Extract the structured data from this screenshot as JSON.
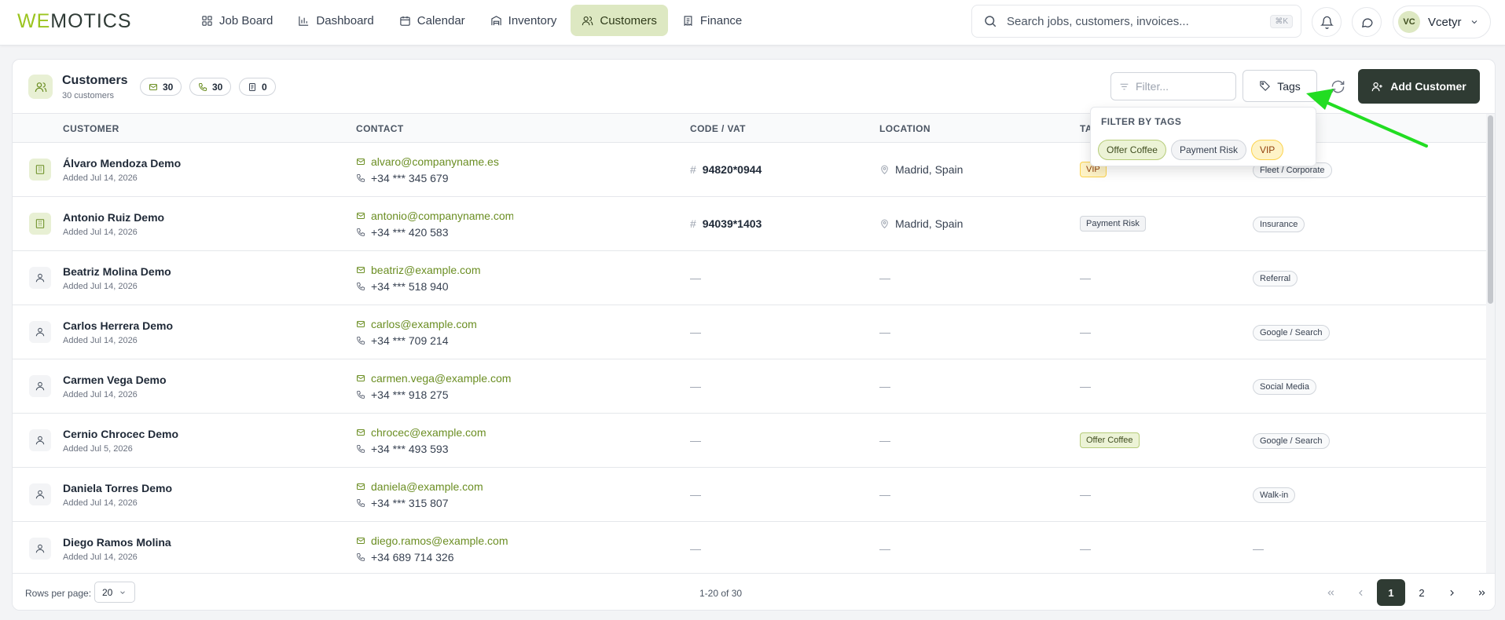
{
  "app": {
    "logo_part1": "WE",
    "logo_part2": "MOTICS"
  },
  "nav": [
    {
      "label": "Job Board",
      "icon": "grid-icon"
    },
    {
      "label": "Dashboard",
      "icon": "bar-chart-icon"
    },
    {
      "label": "Calendar",
      "icon": "calendar-icon"
    },
    {
      "label": "Inventory",
      "icon": "warehouse-icon"
    },
    {
      "label": "Customers",
      "icon": "users-icon",
      "active": true
    },
    {
      "label": "Finance",
      "icon": "receipt-icon"
    }
  ],
  "search": {
    "placeholder": "Search jobs, customers, invoices...",
    "shortcut": "⌘K"
  },
  "user": {
    "initials": "VC",
    "name": "Vcetyr"
  },
  "page": {
    "title": "Customers",
    "subtitle": "30 customers",
    "stats": [
      {
        "icon": "mail-icon",
        "value": "30"
      },
      {
        "icon": "phone-icon",
        "value": "30"
      },
      {
        "icon": "document-icon",
        "value": "0"
      }
    ],
    "filter_placeholder": "Filter...",
    "tags_label": "Tags",
    "add_label": "Add Customer"
  },
  "columns": [
    "CUSTOMER",
    "CONTACT",
    "CODE / VAT",
    "LOCATION",
    "TA"
  ],
  "dropdown": {
    "title": "FILTER BY TAGS",
    "tags": [
      "Offer Coffee",
      "Payment Risk",
      "VIP"
    ]
  },
  "rows": [
    {
      "type": "company",
      "name": "Álvaro Mendoza Demo",
      "added": "Added Jul 14, 2026",
      "email": "alvaro@companyname.es",
      "phone": "+34 *** 345 679",
      "code": "94820*0944",
      "location": "Madrid, Spain",
      "tag": "VIP",
      "tag_style": "vip",
      "source": "Fleet / Corporate"
    },
    {
      "type": "company",
      "name": "Antonio Ruiz Demo",
      "added": "Added Jul 14, 2026",
      "email": "antonio@companyname.com",
      "phone": "+34 *** 420 583",
      "code": "94039*1403",
      "location": "Madrid, Spain",
      "tag": "Payment Risk",
      "tag_style": "risk",
      "source": "Insurance"
    },
    {
      "type": "person",
      "name": "Beatriz Molina Demo",
      "added": "Added Jul 14, 2026",
      "email": "beatriz@example.com",
      "phone": "+34 *** 518 940",
      "code": "",
      "location": "",
      "tag": "",
      "tag_style": "",
      "source": "Referral"
    },
    {
      "type": "person",
      "name": "Carlos Herrera Demo",
      "added": "Added Jul 14, 2026",
      "email": "carlos@example.com",
      "phone": "+34 *** 709 214",
      "code": "",
      "location": "",
      "tag": "",
      "tag_style": "",
      "source": "Google / Search"
    },
    {
      "type": "person",
      "name": "Carmen Vega Demo",
      "added": "Added Jul 14, 2026",
      "email": "carmen.vega@example.com",
      "phone": "+34 *** 918 275",
      "code": "",
      "location": "",
      "tag": "",
      "tag_style": "",
      "source": "Social Media"
    },
    {
      "type": "person",
      "name": "Cernio Chrocec Demo",
      "added": "Added Jul 5, 2026",
      "email": "chrocec@example.com",
      "phone": "+34 *** 493 593",
      "code": "",
      "location": "",
      "tag": "Offer Coffee",
      "tag_style": "coffee",
      "source": "Google / Search"
    },
    {
      "type": "person",
      "name": "Daniela Torres Demo",
      "added": "Added Jul 14, 2026",
      "email": "daniela@example.com",
      "phone": "+34 *** 315 807",
      "code": "",
      "location": "",
      "tag": "",
      "tag_style": "",
      "source": "Walk-in"
    },
    {
      "type": "person",
      "name": "Diego Ramos Molina",
      "added": "Added Jul 14, 2026",
      "email": "diego.ramos@example.com",
      "phone": "+34 689 714 326",
      "code": "",
      "location": "",
      "tag": "",
      "tag_style": "",
      "source": ""
    }
  ],
  "empty_marker": "—",
  "footer": {
    "rows_label": "Rows per page:",
    "rows_value": "20",
    "range": "1-20 of 30",
    "pages": [
      "1",
      "2"
    ]
  },
  "colors": {
    "brand_green": "#9bc41f",
    "dark": "#2f3b33",
    "annotation_arrow": "#22dd22"
  }
}
